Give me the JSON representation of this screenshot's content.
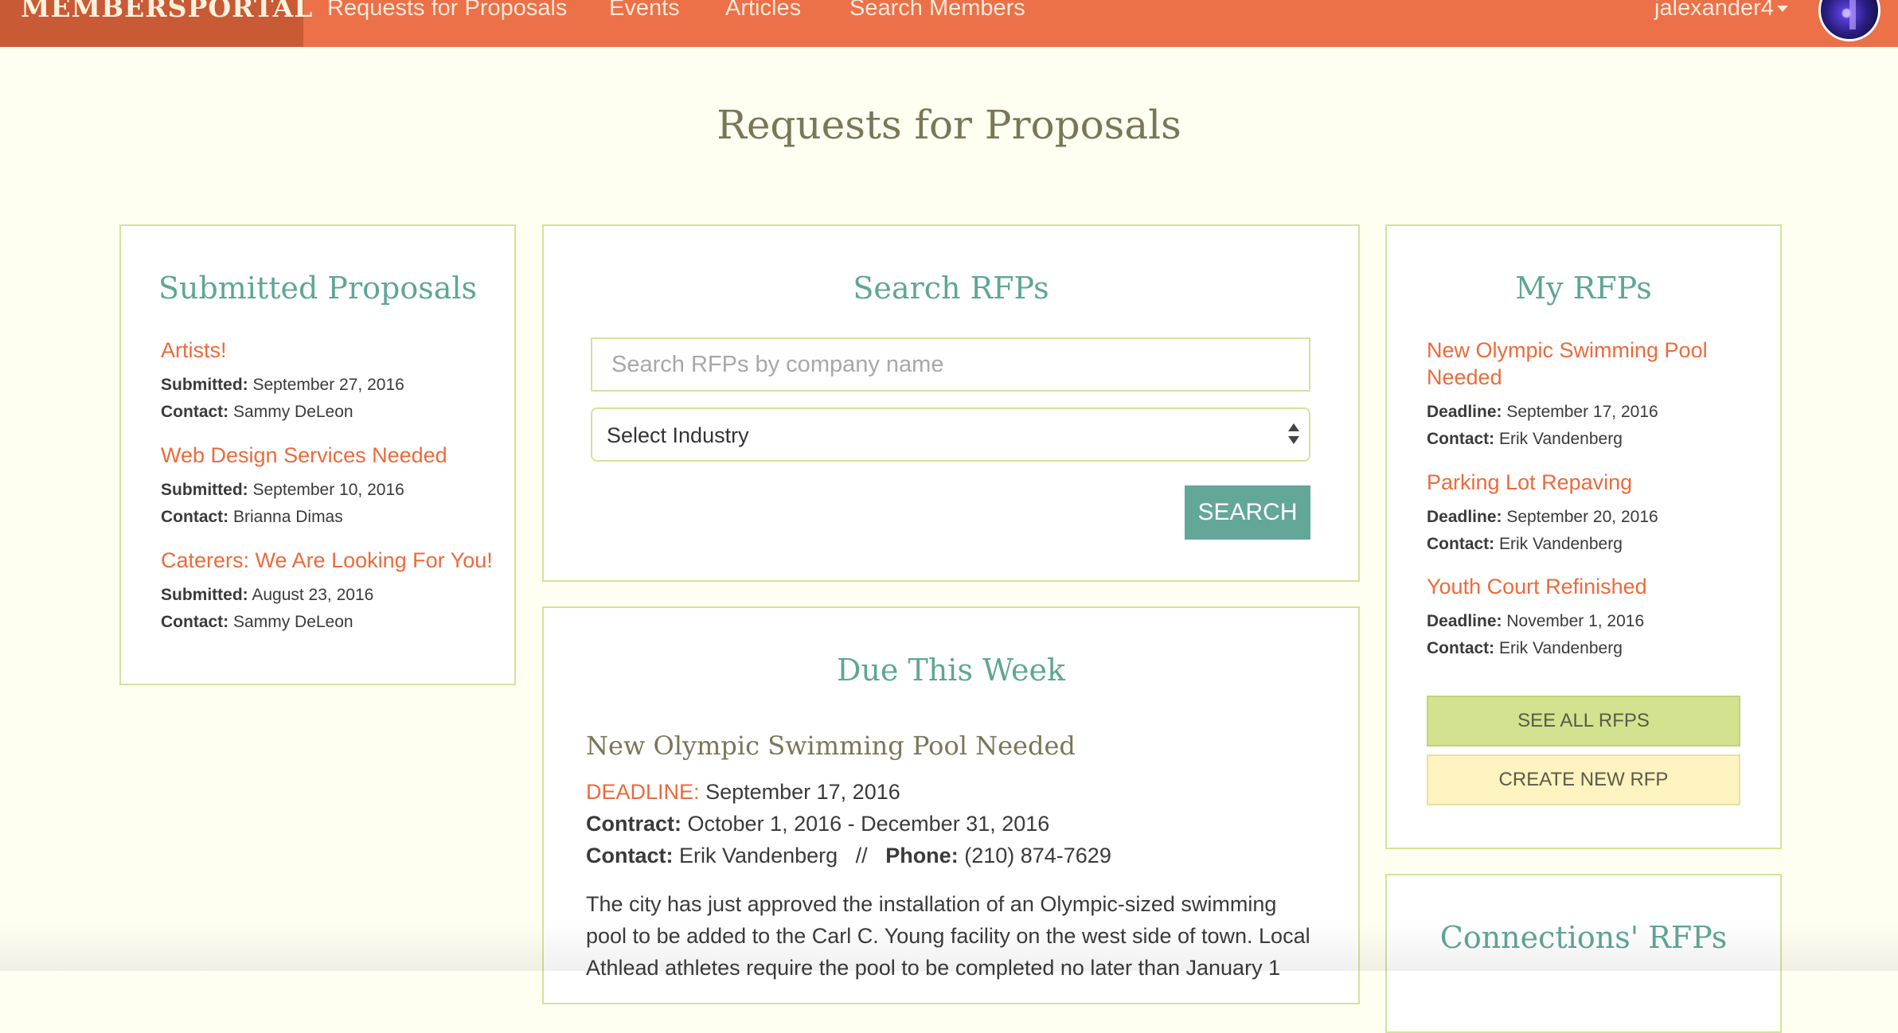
{
  "nav": {
    "brand": "MEMBERSPORTAL",
    "links": [
      "Requests for Proposals",
      "Events",
      "Articles",
      "Search Members"
    ],
    "username": "jalexander4"
  },
  "page": {
    "title": "Requests for Proposals"
  },
  "submitted": {
    "title": "Submitted Proposals",
    "items": [
      {
        "title": "Artists!",
        "submitted_label": "Submitted:",
        "submitted": "September 27, 2016",
        "contact_label": "Contact:",
        "contact": "Sammy DeLeon"
      },
      {
        "title": "Web Design Services Needed",
        "submitted_label": "Submitted:",
        "submitted": "September 10, 2016",
        "contact_label": "Contact:",
        "contact": "Brianna Dimas"
      },
      {
        "title": "Caterers: We Are Looking For You!",
        "submitted_label": "Submitted:",
        "submitted": "August 23, 2016",
        "contact_label": "Contact:",
        "contact": "Sammy DeLeon"
      }
    ]
  },
  "search": {
    "title": "Search RFPs",
    "placeholder": "Search RFPs by company name",
    "industry_selected": "Select Industry",
    "button": "SEARCH"
  },
  "due": {
    "title": "Due This Week",
    "item_title": "New Olympic Swimming Pool Needed",
    "deadline_label": "DEADLINE:",
    "deadline": "September 17, 2016",
    "contract_label": "Contract:",
    "contract": "October 1, 2016 - December 31, 2016",
    "contact_label": "Contact:",
    "contact": "Erik Vandenberg",
    "separator": "//",
    "phone_label": "Phone:",
    "phone": "(210) 874-7629",
    "description": "The city has just approved the installation of an Olympic-sized swimming pool to be added to the Carl C. Young facility on the west side of town. Local Athlead athletes require the pool to be completed no later than January 1"
  },
  "my_rfps": {
    "title": "My RFPs",
    "items": [
      {
        "title": "New Olympic Swimming Pool Needed",
        "deadline_label": "Deadline:",
        "deadline": "September 17, 2016",
        "contact_label": "Contact:",
        "contact": "Erik Vandenberg"
      },
      {
        "title": "Parking Lot Repaving",
        "deadline_label": "Deadline:",
        "deadline": "September 20, 2016",
        "contact_label": "Contact:",
        "contact": "Erik Vandenberg"
      },
      {
        "title": "Youth Court Refinished",
        "deadline_label": "Deadline:",
        "deadline": "November 1, 2016",
        "contact_label": "Contact:",
        "contact": "Erik Vandenberg"
      }
    ],
    "see_all": "SEE ALL RFPS",
    "create_new": "CREATE NEW RFP"
  },
  "connections": {
    "title": "Connections' RFPs"
  }
}
